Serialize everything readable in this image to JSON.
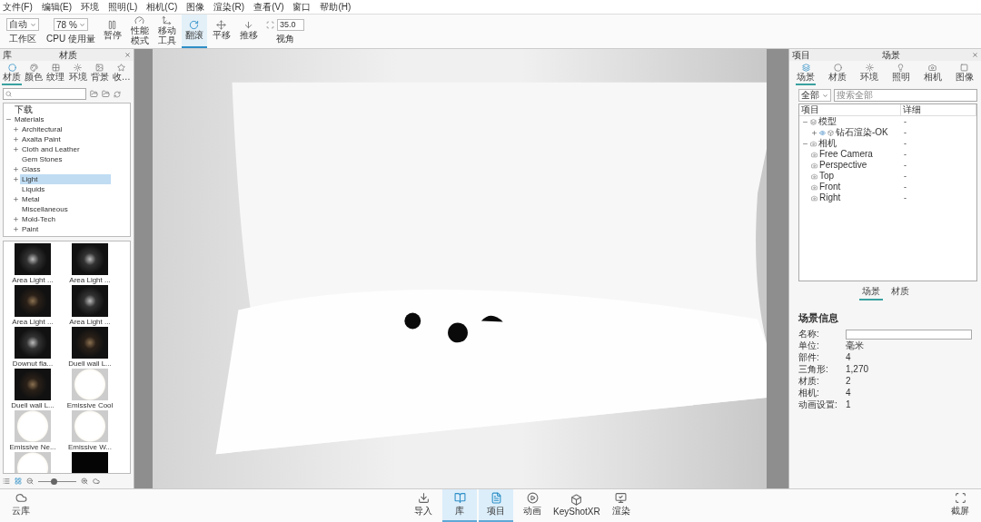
{
  "menu": [
    "文件(F)",
    "编辑(E)",
    "环境",
    "照明(L)",
    "相机(C)",
    "图像",
    "渲染(R)",
    "查看(V)",
    "窗口",
    "帮助(H)"
  ],
  "toolbar": {
    "workspace": {
      "value": "自动",
      "label": "工作区"
    },
    "cpu": {
      "value": "78 %",
      "label": "CPU 使用量"
    },
    "tools": [
      {
        "kind": "pause",
        "label": "暂停",
        "selected": false
      },
      {
        "kind": "performance",
        "label": "性能模式",
        "selected": false
      },
      {
        "kind": "move",
        "label": "移动工具",
        "selected": false
      },
      {
        "kind": "tumble",
        "label": "翻滚",
        "selected": true
      },
      {
        "kind": "pan",
        "label": "平移",
        "selected": false
      },
      {
        "kind": "dolly",
        "label": "推移",
        "selected": false
      }
    ],
    "fov": {
      "value": "35.0",
      "label": "视角"
    }
  },
  "library": {
    "header": "库",
    "title": "材质",
    "tabs": [
      {
        "kind": "material",
        "label": "材质",
        "selected": true
      },
      {
        "kind": "color",
        "label": "颜色",
        "selected": false
      },
      {
        "kind": "texture",
        "label": "纹理",
        "selected": false
      },
      {
        "kind": "environment",
        "label": "环境",
        "selected": false
      },
      {
        "kind": "background",
        "label": "背景",
        "selected": false
      },
      {
        "kind": "favorite",
        "label": "收…",
        "selected": false
      }
    ],
    "tree": [
      {
        "label": "下载",
        "selected": false
      },
      {
        "label": "Materials",
        "expanded": true,
        "selected": false,
        "children": [
          {
            "label": "Architectural",
            "expanded": false,
            "selected": false
          },
          {
            "label": "Axalta Paint",
            "expanded": false,
            "selected": false
          },
          {
            "label": "Cloth and Leather",
            "expanded": false,
            "selected": false
          },
          {
            "label": "Gem Stones",
            "selected": false
          },
          {
            "label": "Glass",
            "expanded": false,
            "selected": false
          },
          {
            "label": "Light",
            "expanded": false,
            "selected": true
          },
          {
            "label": "Liquids",
            "selected": false
          },
          {
            "label": "Metal",
            "expanded": false,
            "selected": false
          },
          {
            "label": "Miscellaneous",
            "selected": false
          },
          {
            "label": "Mold-Tech",
            "expanded": false,
            "selected": false
          },
          {
            "label": "Paint",
            "expanded": false,
            "selected": false
          }
        ]
      }
    ],
    "thumbnails": [
      {
        "label": "Area Light ...",
        "kind": "dark"
      },
      {
        "label": "Area Light ...",
        "kind": "dark"
      },
      {
        "label": "Area Light ...",
        "kind": "warm"
      },
      {
        "label": "Area Light ...",
        "kind": "dark"
      },
      {
        "label": "Downut fla...",
        "kind": "dark"
      },
      {
        "label": "Duell wall L...",
        "kind": "warm"
      },
      {
        "label": "Duell wall L...",
        "kind": "warm"
      },
      {
        "label": "Emissive Cool",
        "kind": "emissive"
      },
      {
        "label": "Emissive Ne...",
        "kind": "emissive"
      },
      {
        "label": "Emissive W...",
        "kind": "emissive"
      },
      {
        "kind": "emissive"
      },
      {
        "kind": "black"
      }
    ],
    "thumb_size": {
      "level": 0.4
    }
  },
  "scene": {
    "header": "项目",
    "title": "场景",
    "tabs": [
      {
        "kind": "scene",
        "label": "场景",
        "selected": true
      },
      {
        "kind": "material",
        "label": "材质",
        "selected": false
      },
      {
        "kind": "environment",
        "label": "环境",
        "selected": false
      },
      {
        "kind": "light",
        "label": "照明",
        "selected": false
      },
      {
        "kind": "camera",
        "label": "相机",
        "selected": false
      },
      {
        "kind": "image",
        "label": "图像",
        "selected": false
      }
    ],
    "filter": "全部",
    "search": {
      "placeholder": "搜索全部"
    },
    "columns": [
      "项目",
      "详细"
    ],
    "tree": [
      {
        "label": "模型",
        "value": "-",
        "kind": "models",
        "expanded": true,
        "children": [
          {
            "label": "钻石渲染-OK",
            "value": "-",
            "kind": "model",
            "expanded": false
          }
        ]
      },
      {
        "label": "相机",
        "value": "-",
        "kind": "cameras",
        "expanded": true,
        "children": [
          {
            "label": "Free Camera",
            "value": "-",
            "kind": "camera"
          },
          {
            "label": "Perspective",
            "value": "-",
            "kind": "camera"
          },
          {
            "label": "Top",
            "value": "-",
            "kind": "camera"
          },
          {
            "label": "Front",
            "value": "-",
            "kind": "camera"
          },
          {
            "label": "Right",
            "value": "-",
            "kind": "camera"
          }
        ]
      }
    ],
    "subtabs": [
      {
        "label": "场景",
        "selected": true
      },
      {
        "label": "材质",
        "selected": false
      }
    ],
    "info": {
      "title": "场景信息",
      "name_label": "名称:",
      "rows": [
        {
          "label": "单位:",
          "value": "毫米"
        },
        {
          "label": "部件:",
          "value": "4"
        },
        {
          "label": "三角形:",
          "value": "1,270"
        },
        {
          "label": "材质:",
          "value": "2"
        },
        {
          "label": "相机:",
          "value": "4"
        },
        {
          "label": "动画设置:",
          "value": "1"
        }
      ]
    }
  },
  "bottom": {
    "cloud": "云库",
    "buttons": [
      {
        "kind": "import",
        "label": "导入",
        "selected": false
      },
      {
        "kind": "library",
        "label": "库",
        "selected": true
      },
      {
        "kind": "project",
        "label": "项目",
        "selected": true
      },
      {
        "kind": "animation",
        "label": "动画",
        "selected": false
      },
      {
        "kind": "xr",
        "label": "KeyShotXR",
        "selected": false
      },
      {
        "kind": "render",
        "label": "渲染",
        "selected": false
      }
    ],
    "screenshot": "截屏"
  }
}
